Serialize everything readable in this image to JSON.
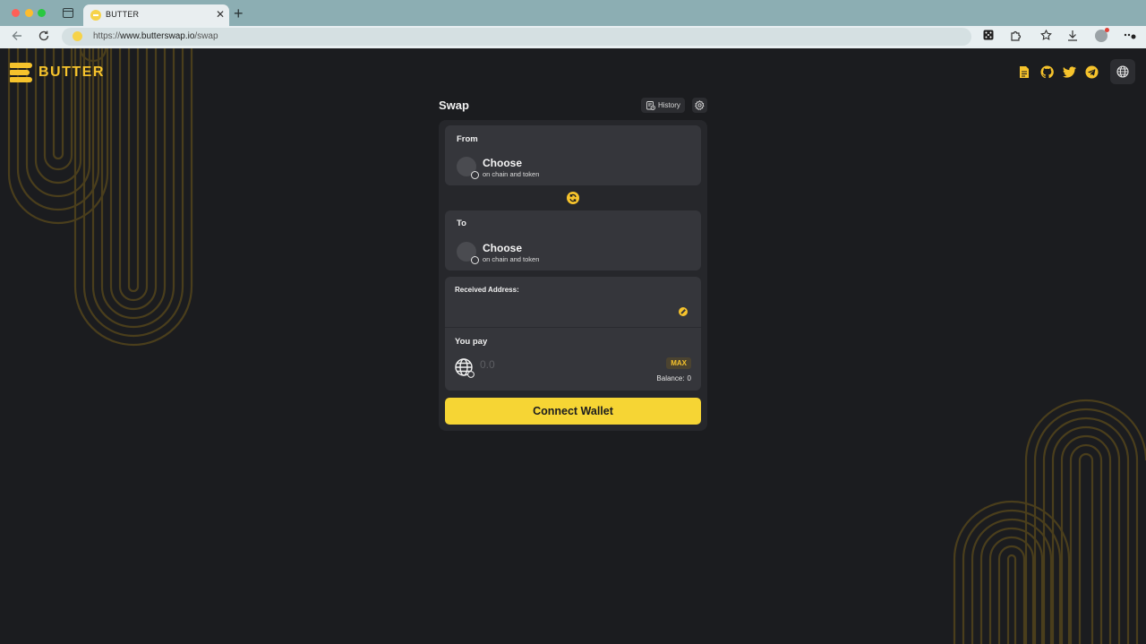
{
  "browser": {
    "tab_title": "BUTTER",
    "tab_close": "✕",
    "new_tab": "+",
    "url_scheme": "https://",
    "url_host": "www.butterswap.io",
    "url_path": "/swap"
  },
  "header": {
    "logo_text": "BUTTER",
    "icons": [
      "docs-icon",
      "github-icon",
      "twitter-icon",
      "telegram-icon",
      "globe-icon"
    ]
  },
  "swap": {
    "title": "Swap",
    "history_label": "History",
    "from": {
      "label": "From",
      "choose": "Choose",
      "sub": "on chain and token"
    },
    "to": {
      "label": "To",
      "choose": "Choose",
      "sub": "on chain and token"
    },
    "received_address_label": "Received Address:",
    "you_pay_label": "You pay",
    "amount_placeholder": "0.0",
    "max_label": "MAX",
    "balance_label": "Balance:",
    "balance_value": "0",
    "connect_label": "Connect Wallet"
  },
  "colors": {
    "accent": "#f6c32c",
    "button": "#f6d534",
    "background": "#1b1c1f",
    "card": "#26272b",
    "panel": "#35363b"
  }
}
